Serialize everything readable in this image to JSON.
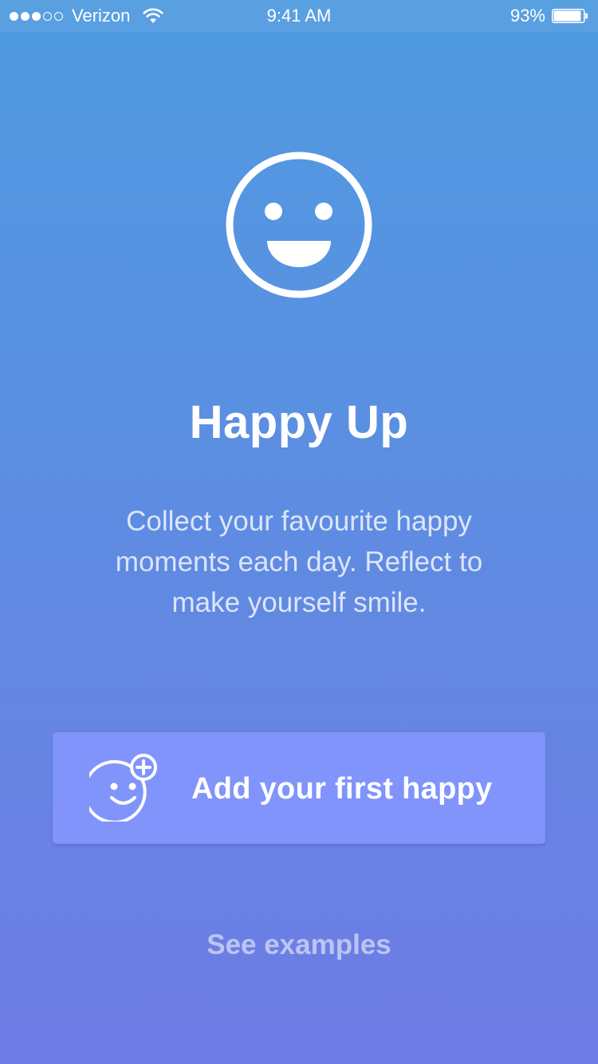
{
  "status_bar": {
    "signal_filled": 3,
    "signal_total": 5,
    "carrier": "Verizon",
    "time": "9:41 AM",
    "battery_percent": "93%",
    "battery_level": 0.93,
    "icons": [
      "signal-dots-icon",
      "wifi-icon",
      "battery-icon"
    ]
  },
  "hero": {
    "icon": "smiley-face-icon"
  },
  "app": {
    "title": "Happy Up",
    "tagline_lines": [
      "Collect your favourite happy",
      "moments each day. Reflect to",
      "make yourself smile."
    ]
  },
  "primary_action": {
    "label": "Add your first happy",
    "icon": "add-happy-icon"
  },
  "secondary_action": {
    "label": "See examples"
  },
  "colors": {
    "background_top": "#4f9be0",
    "background_bottom": "#6d7be4",
    "button_fill": "#8094fc",
    "text": "#ffffff"
  }
}
